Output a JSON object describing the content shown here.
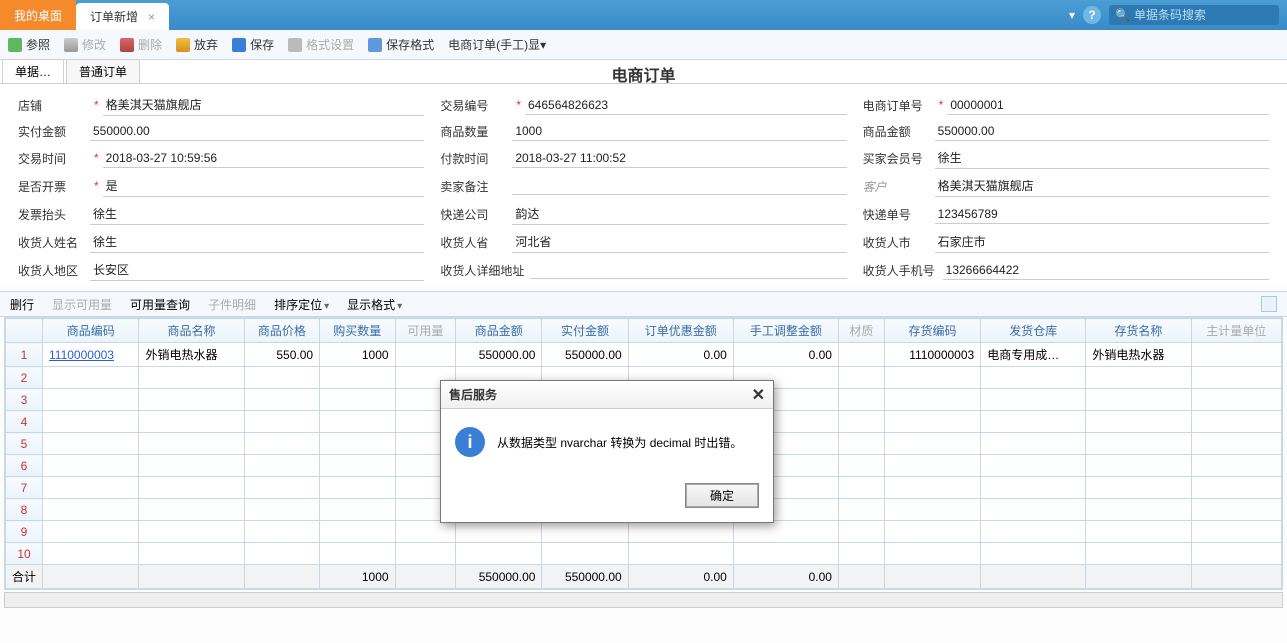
{
  "tabs": {
    "desktop": "我的桌面",
    "order_add": "订单新增"
  },
  "search": {
    "placeholder": "单据条码搜索"
  },
  "toolbar": {
    "reference": "参照",
    "edit": "修改",
    "delete": "删除",
    "discard": "放弃",
    "save": "保存",
    "format": "格式设置",
    "save_format": "保存格式",
    "ecom_manual": "电商订单(手工)显▾"
  },
  "subtabs": {
    "danju": "单据…",
    "normal": "普通订单"
  },
  "doc_title": "电商订单",
  "form": {
    "shop_lbl": "店铺",
    "shop_val": "格美淇天猫旗舰店",
    "actual_amt_lbl": "实付金额",
    "actual_amt_val": "550000.00",
    "trade_time_lbl": "交易时间",
    "trade_time_val": "2018-03-27 10:59:56",
    "invoice_lbl": "是否开票",
    "invoice_val": "是",
    "invoice_title_lbl": "发票抬头",
    "invoice_title_val": "徐生",
    "recv_name_lbl": "收货人姓名",
    "recv_name_val": "徐生",
    "recv_area_lbl": "收货人地区",
    "recv_area_val": "长安区",
    "trade_no_lbl": "交易编号",
    "trade_no_val": "646564826623",
    "qty_lbl": "商品数量",
    "qty_val": "1000",
    "pay_time_lbl": "付款时间",
    "pay_time_val": "2018-03-27 11:00:52",
    "seller_remark_lbl": "卖家备注",
    "seller_remark_val": "",
    "express_co_lbl": "快递公司",
    "express_co_val": "韵达",
    "recv_prov_lbl": "收货人省",
    "recv_prov_val": "河北省",
    "recv_addr_lbl": "收货人详细地址",
    "recv_addr_val": "",
    "ecom_no_lbl": "电商订单号",
    "ecom_no_val": "00000001",
    "goods_amt_lbl": "商品金额",
    "goods_amt_val": "550000.00",
    "buyer_id_lbl": "买家会员号",
    "buyer_id_val": "徐生",
    "customer_lbl": "客户",
    "customer_val": "格美淇天猫旗舰店",
    "express_no_lbl": "快递单号",
    "express_no_val": "123456789",
    "recv_city_lbl": "收货人市",
    "recv_city_val": "石家庄市",
    "recv_phone_lbl": "收货人手机号",
    "recv_phone_val": "13266664422"
  },
  "grid_toolbar": {
    "delrow": "删行",
    "show_avail": "显示可用量",
    "avail_query": "可用量查询",
    "sub_detail": "子件明细",
    "sort": "排序定位",
    "display_fmt": "显示格式"
  },
  "grid_headers": {
    "code": "商品编码",
    "name": "商品名称",
    "price": "商品价格",
    "buy_qty": "购买数量",
    "avail": "可用量",
    "amount": "商品金额",
    "paid": "实付金额",
    "discount": "订单优惠金额",
    "manual_adj": "手工调整金额",
    "material": "材质",
    "inv_code": "存货编码",
    "ship_wh": "发货仓库",
    "inv_name": "存货名称",
    "unit": "主计量单位"
  },
  "grid_row": {
    "idx": "1",
    "code": "1110000003",
    "name": "外销电热水器",
    "price": "550.00",
    "buy_qty": "1000",
    "amount": "550000.00",
    "paid": "550000.00",
    "discount": "0.00",
    "manual_adj": "0.00",
    "inv_code": "1110000003",
    "ship_wh": "电商专用成…",
    "inv_name": "外销电热水器"
  },
  "empty_rows": [
    "2",
    "3",
    "4",
    "5",
    "6",
    "7",
    "8",
    "9",
    "10"
  ],
  "grid_total": {
    "label": "合计",
    "buy_qty": "1000",
    "amount": "550000.00",
    "paid": "550000.00",
    "discount": "0.00",
    "manual_adj": "0.00"
  },
  "modal": {
    "title": "售后服务",
    "message": "从数据类型 nvarchar 转换为 decimal 时出错。",
    "ok": "确定"
  }
}
